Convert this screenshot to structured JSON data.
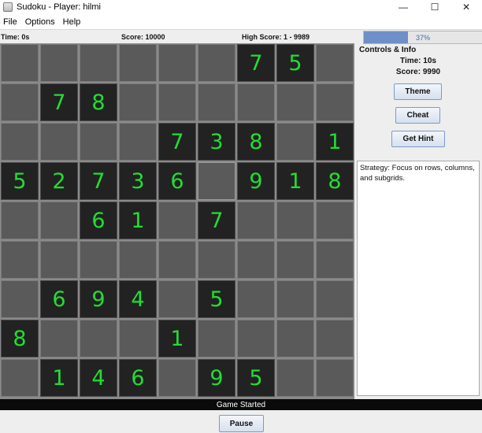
{
  "window": {
    "title": "Sudoku - Player: hilmi",
    "minimize": "—",
    "maximize": "☐",
    "close": "✕"
  },
  "menu": [
    "File",
    "Options",
    "Help"
  ],
  "stats": {
    "time": "Time: 0s",
    "score": "Score: 10000",
    "high_score": "High Score: 1 - 9989"
  },
  "progress": {
    "value": 0.37,
    "label": "37%"
  },
  "panel": {
    "title": "Controls & Info",
    "time": "Time: 10s",
    "score": "Score: 9990",
    "theme_button": "Theme",
    "cheat_button": "Cheat",
    "hint_button": "Get Hint",
    "strategy": "Strategy: Focus on rows, columns, and subgrids."
  },
  "board": [
    [
      "",
      "",
      "",
      "",
      "",
      "",
      "7",
      "5",
      ""
    ],
    [
      "",
      "7",
      "8",
      "",
      "",
      "",
      "",
      "",
      ""
    ],
    [
      "",
      "",
      "",
      "",
      "7",
      "3",
      "8",
      "",
      "1"
    ],
    [
      "5",
      "2",
      "7",
      "3",
      "6",
      "",
      "9",
      "1",
      "8"
    ],
    [
      "",
      "",
      "6",
      "1",
      "",
      "7",
      "",
      "",
      ""
    ],
    [
      "",
      "",
      "",
      "",
      "",
      "",
      "",
      "",
      ""
    ],
    [
      "",
      "6",
      "9",
      "4",
      "",
      "5",
      "",
      "",
      ""
    ],
    [
      "8",
      "",
      "",
      "",
      "1",
      "",
      "",
      "",
      ""
    ],
    [
      "",
      "1",
      "4",
      "6",
      "",
      "9",
      "5",
      "",
      ""
    ]
  ],
  "colors": {
    "digit": "#22dd33",
    "filled_cell": "#222222",
    "empty_cell": "#5a5a5a",
    "progress_fill": "#6f8fc7"
  },
  "status": "Game Started",
  "pause_button": "Pause"
}
